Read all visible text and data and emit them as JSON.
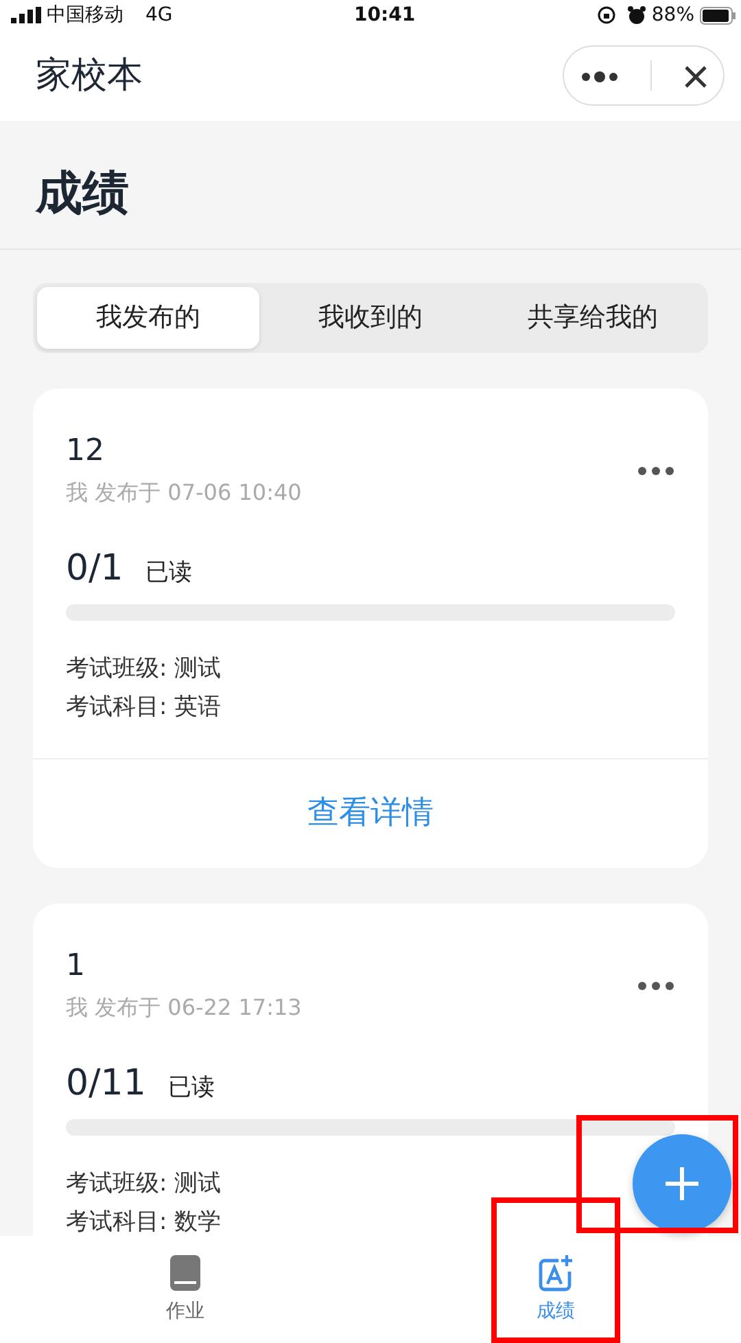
{
  "status_bar": {
    "carrier": "中国移动",
    "network": "4G",
    "time": "10:41",
    "battery": "88%"
  },
  "header": {
    "title": "家校本"
  },
  "page_title": "成绩",
  "segments": [
    {
      "label": "我发布的",
      "selected": true
    },
    {
      "label": "我收到的",
      "selected": false
    },
    {
      "label": "共享给我的",
      "selected": false
    }
  ],
  "cards": [
    {
      "title": "12",
      "meta": "我 发布于 07-06 10:40",
      "count": "0/1",
      "count_label": "已读",
      "level": 0,
      "fields": [
        "考试班级: 测试",
        "考试科目: 英语"
      ],
      "action": "查看详情"
    },
    {
      "title": "1",
      "meta": "我 发布于 06-22 17:13",
      "count": "0/11",
      "count_label": "已读",
      "level": 0,
      "fields": [
        "考试班级: 测试",
        "考试科目: 数学"
      ]
    }
  ],
  "tab_bar": [
    {
      "label": "作业",
      "kind": "book",
      "selected": false,
      "highlighted": false
    },
    {
      "label": "成绩",
      "kind": "score",
      "selected": true,
      "highlighted": true
    }
  ],
  "add_button": {
    "highlighted": true
  }
}
